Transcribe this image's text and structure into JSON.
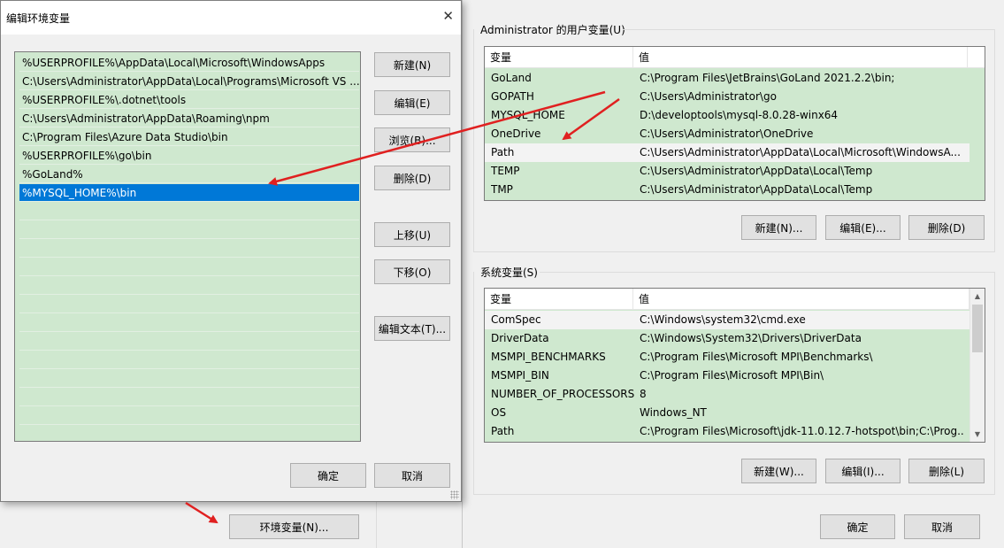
{
  "background": {
    "env_button": "环境变量(N)..."
  },
  "main": {
    "user_group_title": "Administrator 的用户变量(U)",
    "user_table": {
      "headers": [
        "变量",
        "值"
      ],
      "rows": [
        {
          "name": "GoLand",
          "value": "C:\\Program Files\\JetBrains\\GoLand 2021.2.2\\bin;"
        },
        {
          "name": "GOPATH",
          "value": "C:\\Users\\Administrator\\go"
        },
        {
          "name": "MYSQL_HOME",
          "value": "D:\\developtools\\mysql-8.0.28-winx64"
        },
        {
          "name": "OneDrive",
          "value": "C:\\Users\\Administrator\\OneDrive"
        },
        {
          "name": "Path",
          "value": "C:\\Users\\Administrator\\AppData\\Local\\Microsoft\\WindowsA..."
        },
        {
          "name": "TEMP",
          "value": "C:\\Users\\Administrator\\AppData\\Local\\Temp"
        },
        {
          "name": "TMP",
          "value": "C:\\Users\\Administrator\\AppData\\Local\\Temp"
        }
      ]
    },
    "user_buttons": {
      "new": "新建(N)...",
      "edit": "编辑(E)...",
      "delete": "删除(D)"
    },
    "system_group_title": "系统变量(S)",
    "system_table": {
      "headers": [
        "变量",
        "值"
      ],
      "rows": [
        {
          "name": "ComSpec",
          "value": "C:\\Windows\\system32\\cmd.exe"
        },
        {
          "name": "DriverData",
          "value": "C:\\Windows\\System32\\Drivers\\DriverData"
        },
        {
          "name": "MSMPI_BENCHMARKS",
          "value": "C:\\Program Files\\Microsoft MPI\\Benchmarks\\"
        },
        {
          "name": "MSMPI_BIN",
          "value": "C:\\Program Files\\Microsoft MPI\\Bin\\"
        },
        {
          "name": "NUMBER_OF_PROCESSORS",
          "value": "8"
        },
        {
          "name": "OS",
          "value": "Windows_NT"
        },
        {
          "name": "Path",
          "value": "C:\\Program Files\\Microsoft\\jdk-11.0.12.7-hotspot\\bin;C:\\Prog..."
        }
      ]
    },
    "system_buttons": {
      "new": "新建(W)...",
      "edit": "编辑(I)...",
      "delete": "删除(L)"
    },
    "ok": "确定",
    "cancel": "取消"
  },
  "dialog": {
    "title": "编辑环境变量",
    "close_glyph": "✕",
    "items": [
      "%USERPROFILE%\\AppData\\Local\\Microsoft\\WindowsApps",
      "C:\\Users\\Administrator\\AppData\\Local\\Programs\\Microsoft VS ...",
      "%USERPROFILE%\\.dotnet\\tools",
      "C:\\Users\\Administrator\\AppData\\Roaming\\npm",
      "C:\\Program Files\\Azure Data Studio\\bin",
      "%USERPROFILE%\\go\\bin",
      "%GoLand%",
      "%MYSQL_HOME%\\bin"
    ],
    "selected_index": 7,
    "buttons": {
      "new": "新建(N)",
      "edit": "编辑(E)",
      "browse": "浏览(B)...",
      "delete": "删除(D)",
      "move_up": "上移(U)",
      "move_down": "下移(O)",
      "edit_text": "编辑文本(T)..."
    },
    "ok": "确定",
    "cancel": "取消"
  },
  "colors": {
    "list_bg": "#cfe8cf",
    "selection": "#0078d7",
    "arrow": "#e02020"
  }
}
